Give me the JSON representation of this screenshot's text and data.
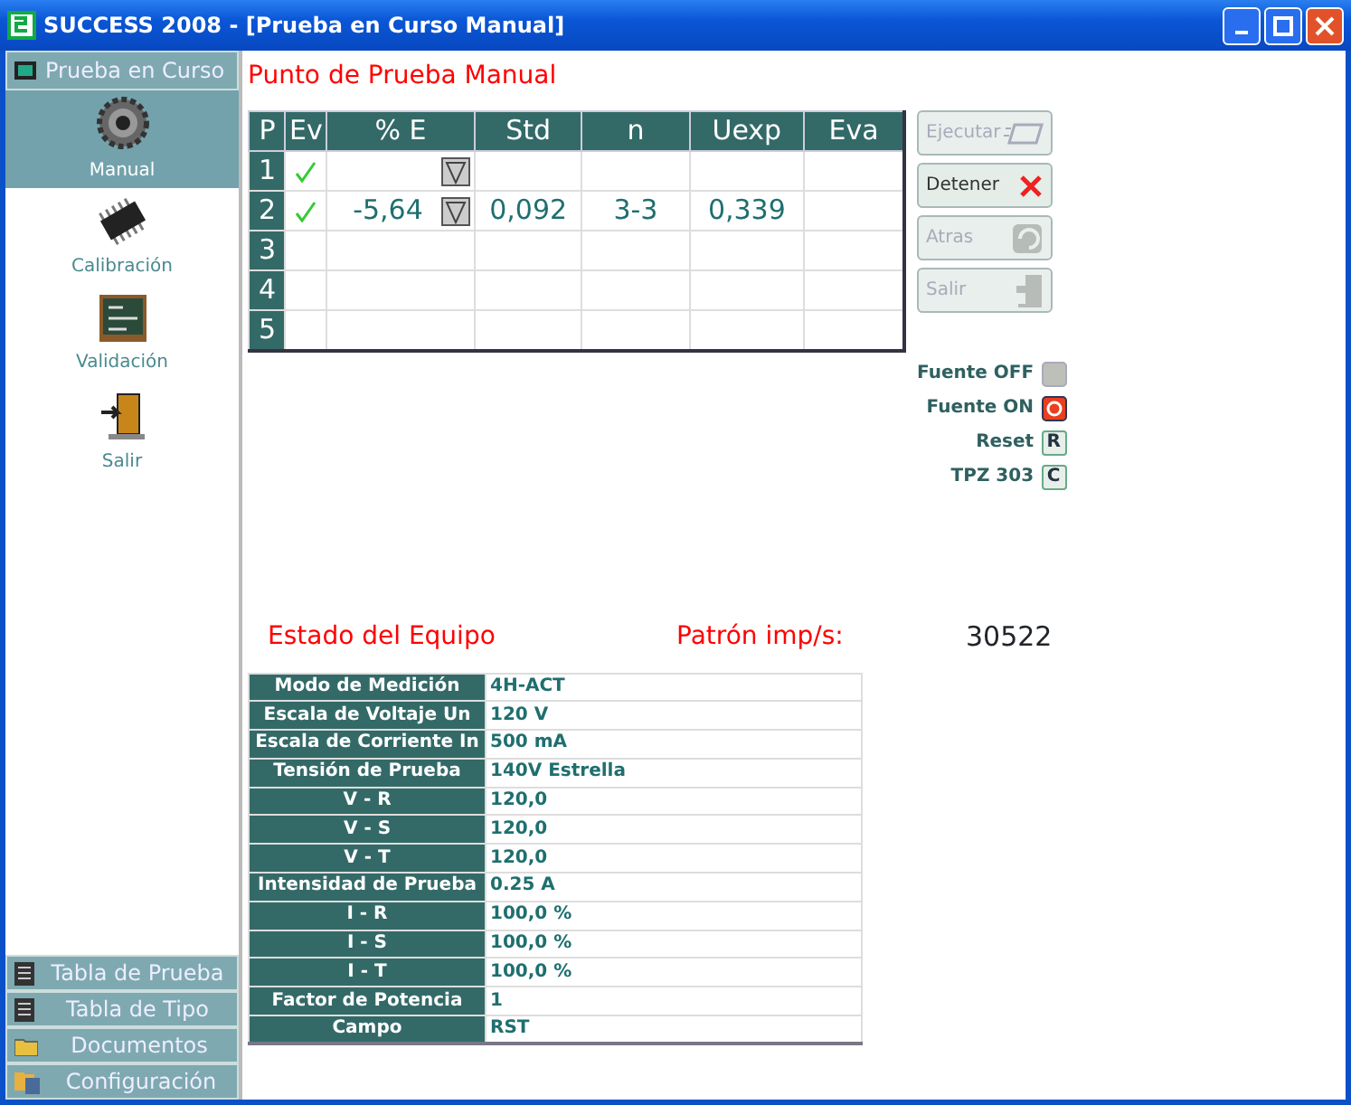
{
  "window": {
    "title": "SUCCESS 2008 - [Prueba en Curso Manual]"
  },
  "sidebar": {
    "header": "Prueba en Curso",
    "tools": [
      {
        "label": "Manual",
        "selected": true
      },
      {
        "label": "Calibración",
        "selected": false
      },
      {
        "label": "Validación",
        "selected": false
      },
      {
        "label": "Salir",
        "selected": false
      }
    ],
    "sections": [
      {
        "label": "Tabla de Prueba"
      },
      {
        "label": "Tabla de Tipo"
      },
      {
        "label": "Documentos"
      },
      {
        "label": "Configuración"
      }
    ]
  },
  "test_point": {
    "title": "Punto de Prueba Manual",
    "columns": [
      "P",
      "Ev",
      "% E",
      "Std",
      "n",
      "Uexp",
      "Eva"
    ],
    "rows": [
      {
        "p": "1",
        "ev_ok": true,
        "e": "",
        "filter": true,
        "std": "",
        "n": "",
        "uexp": "",
        "eva": ""
      },
      {
        "p": "2",
        "ev_ok": true,
        "e": "-5,64",
        "filter": true,
        "std": "0,092",
        "n": "3-3",
        "uexp": "0,339",
        "eva": ""
      },
      {
        "p": "3",
        "ev_ok": false,
        "e": "",
        "filter": false,
        "std": "",
        "n": "",
        "uexp": "",
        "eva": ""
      },
      {
        "p": "4",
        "ev_ok": false,
        "e": "",
        "filter": false,
        "std": "",
        "n": "",
        "uexp": "",
        "eva": ""
      },
      {
        "p": "5",
        "ev_ok": false,
        "e": "",
        "filter": false,
        "std": "",
        "n": "",
        "uexp": "",
        "eva": ""
      }
    ]
  },
  "actions": [
    {
      "label": "Ejecutar",
      "disabled": true
    },
    {
      "label": "Detener",
      "disabled": false
    },
    {
      "label": "Atras",
      "disabled": true
    },
    {
      "label": "Salir",
      "disabled": true
    }
  ],
  "indicators": [
    {
      "label": "Fuente OFF",
      "kind": "led",
      "lit": false
    },
    {
      "label": "Fuente ON",
      "kind": "led",
      "lit": true
    },
    {
      "label": "Reset",
      "kind": "key",
      "key": "R"
    },
    {
      "label": "TPZ 303",
      "kind": "key",
      "key": "C"
    }
  ],
  "status": {
    "title": "Estado del Equipo",
    "rate_label": "Patrón imp/s:",
    "rate_value": "30522",
    "rows": [
      {
        "label": "Modo de Medición",
        "value": "4H-ACT"
      },
      {
        "label": "Escala de Voltaje Un",
        "value": "120 V"
      },
      {
        "label": "Escala de Corriente In",
        "value": "500 mA"
      },
      {
        "label": "Tensión de Prueba",
        "value": "140V Estrella"
      },
      {
        "label": "V - R",
        "value": "120,0"
      },
      {
        "label": "V - S",
        "value": "120,0"
      },
      {
        "label": "V - T",
        "value": "120,0"
      },
      {
        "label": "Intensidad de Prueba",
        "value": "0.25 A"
      },
      {
        "label": "I - R",
        "value": "100,0 %"
      },
      {
        "label": "I - S",
        "value": "100,0 %"
      },
      {
        "label": "I - T",
        "value": "100,0 %"
      },
      {
        "label": "Factor de Potencia",
        "value": "1"
      },
      {
        "label": "Campo",
        "value": "RST"
      }
    ]
  }
}
